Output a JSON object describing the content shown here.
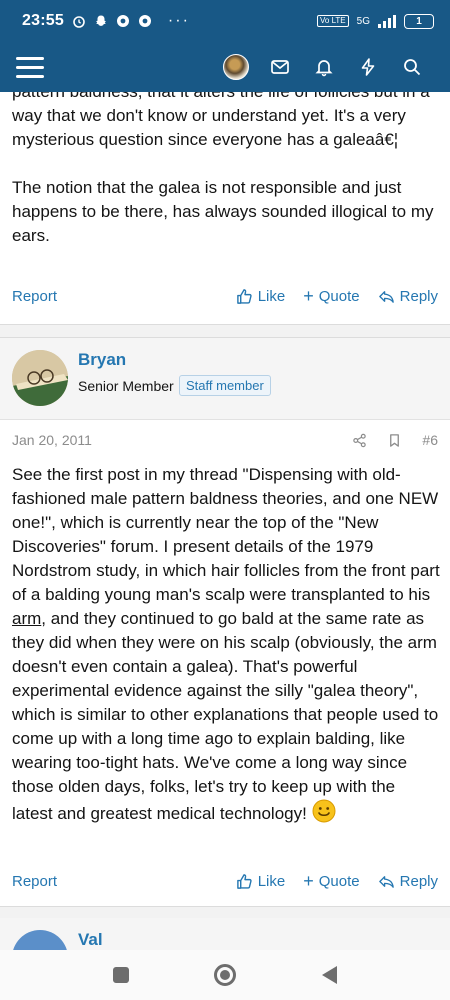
{
  "status_bar": {
    "time": "23:55",
    "network": "5G",
    "volte": "Vo LTE",
    "battery": "1"
  },
  "post1": {
    "text_lines_top": "pattern baldness, that it alters the life of follicles but in a way that we don't know or understand yet. It's a very mysterious question since everyone has a galeaâ€¦",
    "text_para2": "The notion that the galea is not responsible and just happens to be there, has always sounded illogical to my ears.",
    "actions": {
      "report": "Report",
      "like": "Like",
      "quote": "Quote",
      "reply": "Reply"
    }
  },
  "post2": {
    "author": "Bryan",
    "user_title": "Senior Member",
    "badge": "Staff member",
    "date": "Jan 20, 2011",
    "post_number": "#6",
    "text_before_arm": "See the first post in my thread \"Dispensing with old-fashioned male pattern baldness theories, and one NEW one!\", which is currently near the top of the \"New Discoveries\" forum. I present details of the 1979 Nordstrom study, in which hair follicles from the front part of a balding young man's scalp were transplanted to his ",
    "text_arm": "arm",
    "text_after_arm": ", and they continued to go bald at the same rate as they did when they were on his scalp (obviously, the arm doesn't even contain a galea). That's powerful experimental evidence against the silly \"galea theory\", which is similar to other explanations that people used to come up with a long time ago to explain balding, like wearing too-tight hats. We've come a long way since those olden days, folks, let's try to keep up with the latest and greatest medical technology! ",
    "actions": {
      "report": "Report",
      "like": "Like",
      "quote": "Quote",
      "reply": "Reply"
    }
  },
  "post3": {
    "author": "Val"
  },
  "colors": {
    "header": "#185886",
    "link": "#2577b1"
  }
}
